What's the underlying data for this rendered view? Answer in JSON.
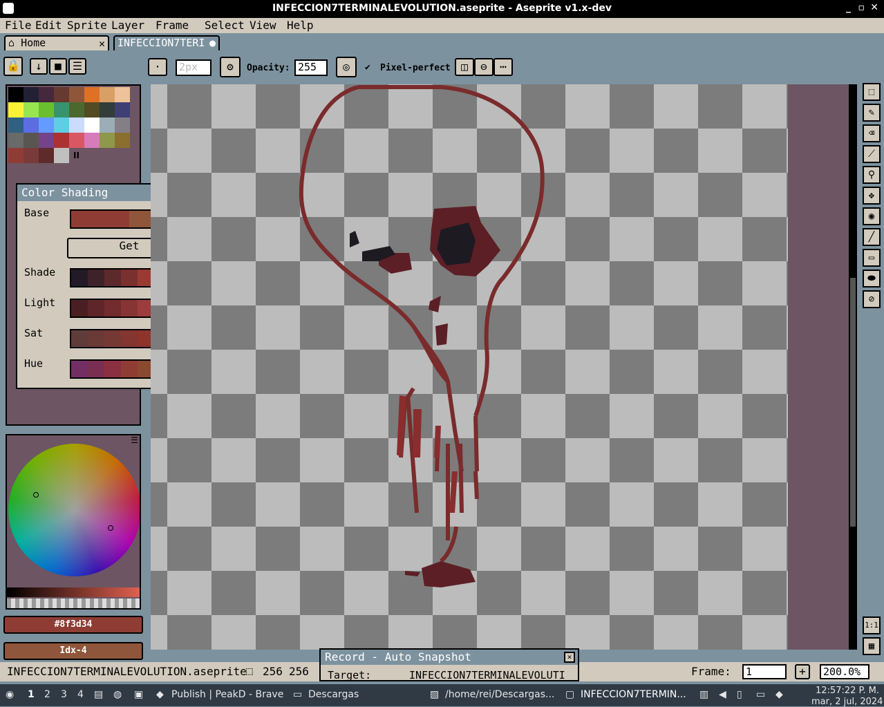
{
  "window": {
    "title": "INFECCION7TERMINALEVOLUTION.aseprite - Aseprite v1.x-dev"
  },
  "menu": [
    "File",
    "Edit",
    "Sprite",
    "Layer",
    "Frame",
    "Select",
    "View",
    "Help"
  ],
  "tabs": [
    {
      "label": "Home",
      "close": "✕"
    },
    {
      "label": "INFECCION7TERI",
      "modified": "●"
    }
  ],
  "toolbar": {
    "brush_size": "2px",
    "opacity_label": "Opacity:",
    "opacity_value": "255",
    "pixel_perfect_label": "Pixel-perfect",
    "pixel_perfect_checked": true
  },
  "palette": {
    "colors": [
      "#000000",
      "#222034",
      "#45283c",
      "#663931",
      "#8f563b",
      "#df7126",
      "#d9a066",
      "#eec39a",
      "#fbf236",
      "#99e550",
      "#6abe30",
      "#37946e",
      "#4b692f",
      "#524b24",
      "#323c39",
      "#3f3f74",
      "#306082",
      "#5b6ee1",
      "#639bff",
      "#5fcde4",
      "#cbdbfc",
      "#ffffff",
      "#9badb7",
      "#847e87",
      "#696a6a",
      "#595652",
      "#76428a",
      "#ac3232",
      "#d95763",
      "#d77bba",
      "#8f974a",
      "#8a6f30",
      "#8f3d34",
      "#7a3a3a",
      "#5e2a2a",
      "#c0c0c0"
    ],
    "more_label": "II"
  },
  "color_shading": {
    "title": "Color Shading",
    "base_label": "Base",
    "base_colors": [
      "#8f3d34",
      "#8f563b"
    ],
    "get_label": "Get",
    "shade_label": "Shade",
    "shade_colors": [
      "#221a26",
      "#3e222a",
      "#5d2a2c",
      "#7a302f",
      "#9a3a33",
      "#b94e38",
      "#d98a5e"
    ],
    "light_label": "Light",
    "light_colors": [
      "#4a1f23",
      "#5e2629",
      "#722c2e",
      "#873434",
      "#9c3c3c",
      "#b14a4a",
      "#c86a68"
    ],
    "sat_label": "Sat",
    "sat_colors": [
      "#5e3c3a",
      "#6a3a36",
      "#763833",
      "#82362f",
      "#8e342b",
      "#9a2c24",
      "#a8221a"
    ],
    "hue_label": "Hue",
    "hue_colors": [
      "#732f64",
      "#7a2f52",
      "#8b3040",
      "#8f3d34",
      "#8b4a30",
      "#7d5a2c",
      "#6e6a2e"
    ]
  },
  "color_bars": {
    "foreground_hex": "#8f3d34",
    "foreground_color": "#8f3d34",
    "background_label": "Idx-4",
    "background_color": "#8f563b"
  },
  "status": {
    "filename": "INFECCION7TERMINALEVOLUTION.aseprite",
    "size_w": "256",
    "size_h": "256",
    "frame_label": "Frame:",
    "frame_value": "1",
    "add_frame": "+",
    "zoom": "200.0%"
  },
  "record": {
    "title": "Record - Auto Snapshot",
    "target_label": "Target:",
    "target_value": "INFECCION7TERMINALEVOLUTI"
  },
  "taskbar": {
    "workspaces": [
      "1",
      "2",
      "3",
      "4"
    ],
    "tasks": [
      "Publish | PeakD - Brave",
      "Descargas",
      "/home/rei/Descargas...",
      "INFECCION7TERMIN..."
    ],
    "time": "12:57:22 P. M.",
    "date": "mar, 2 jul, 2024"
  },
  "colors": {
    "accent": "#7d929f",
    "panel": "#d2cabd",
    "timeline_bg": "#6d5563"
  }
}
